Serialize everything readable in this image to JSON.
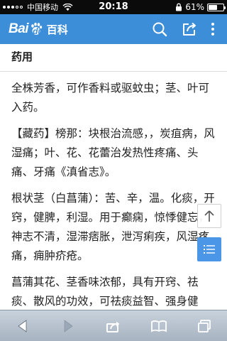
{
  "status_bar": {
    "carrier": "中国移动",
    "time": "20:18",
    "battery": "61%",
    "battery_level": 0.61,
    "icons": [
      "signal-dots",
      "wifi-icon",
      "lock-rotation-icon",
      "battery-icon"
    ]
  },
  "header": {
    "logo_text": "Bai",
    "logo_du": "du",
    "logo_suffix": "百科",
    "background": "#3d8ed9",
    "icons": [
      "search-icon",
      "share-icon",
      "more-vertical-icon"
    ]
  },
  "article": {
    "section_title": "药用",
    "paragraphs": [
      "全株芳香，可作香料或驱蚊虫；茎、叶可入药。",
      "【藏药】榜那：块根治流感，，炭疽病，风湿痛；叶、花、花蕾治发热性疼痛、头痛、牙痛《滇省志》。",
      "根状茎（白菖蒲）：苦、辛，温。化痰，开窍，健脾，利湿。用于癫痫，惊悸健忘，神志不清，湿滞痞胀，泄泻痢疾，风湿疼痛，痈肿疥疮。",
      "菖蒲其花、茎香味浓郁，具有开窍、祛痰、散风的功效，可祛痰益智、强身健体。历代中医典籍均把菖蒲根茎作为益智"
    ]
  },
  "floating": {
    "top_label": "个",
    "icons": [
      "back-to-top-icon",
      "toc-list-icon"
    ],
    "accent": "#4b96e6"
  },
  "toolbar": {
    "icons": [
      "back-arrow-icon",
      "forward-arrow-icon",
      "share-action-icon",
      "bookmarks-icon",
      "tabs-icon"
    ]
  }
}
